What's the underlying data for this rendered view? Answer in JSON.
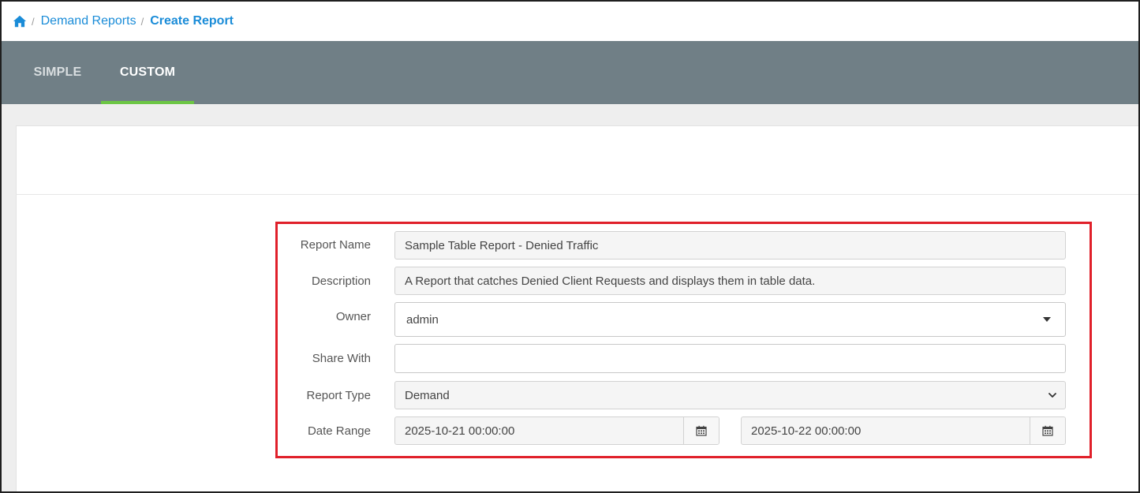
{
  "breadcrumb": {
    "home_icon": "home-icon",
    "items": [
      "Demand Reports",
      "Create Report"
    ],
    "separator": "/"
  },
  "tabs": [
    {
      "label": "SIMPLE",
      "active": false
    },
    {
      "label": "CUSTOM",
      "active": true
    }
  ],
  "form": {
    "report_name": {
      "label": "Report Name",
      "value": "Sample Table Report - Denied Traffic"
    },
    "description": {
      "label": "Description",
      "value": "A Report that catches Denied Client Requests and displays them in table data."
    },
    "owner": {
      "label": "Owner",
      "value": "admin"
    },
    "share_with": {
      "label": "Share With",
      "value": ""
    },
    "report_type": {
      "label": "Report Type",
      "value": "Demand"
    },
    "date_range": {
      "label": "Date Range",
      "start": "2025-10-21 00:00:00",
      "end": "2025-10-22 00:00:00"
    }
  },
  "colors": {
    "link": "#1a8cd8",
    "tab_bar": "#707f86",
    "active_tab_underline": "#6cc644",
    "highlight_border": "#e0202a"
  }
}
